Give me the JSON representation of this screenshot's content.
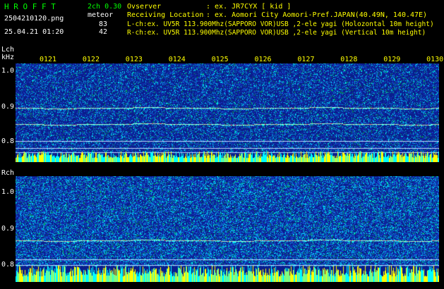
{
  "header": {
    "logo": "H R O F F T",
    "channels": "2ch 0.30",
    "meteor_label": "meteor",
    "filename": "2504210120.png",
    "datetime": "25.04.21 01:20",
    "lch_count": "83",
    "rch_count": "42",
    "observer_label": "Ovserver",
    "observer_value": ": ex. JR7CYX [ kid ]",
    "location_label": "Receiving Location",
    "location_value": ": ex. Aomori City Aomori-Pref.JAPAN(40.49N, 140.47E)",
    "lch_desc": "L-ch:ex. UV5R 113.900Mhz(SAPPORO VOR)USB ,2-ele yagi (Holozontal 10m height)",
    "rch_desc": "R-ch:ex. UV5R 113.900Mhz(SAPPORO VOR)USB ,2-ele yagi (Vertical 10m height)"
  },
  "time_ticks": [
    "0121",
    "0122",
    "0123",
    "0124",
    "0125",
    "0126",
    "0127",
    "0128",
    "0129",
    "0130"
  ],
  "lch_panel": {
    "label": "Lch",
    "unit": "kHz",
    "yticks": [
      "1.0",
      "0.9",
      "0.8"
    ],
    "signal_freqs_khz": [
      0.895,
      0.853
    ]
  },
  "rch_panel": {
    "label": "Rch",
    "yticks": [
      "1.0",
      "0.9",
      "0.8"
    ],
    "signal_freqs_khz": [
      0.868
    ]
  },
  "colors": {
    "background": "#000000",
    "spectrogram_bg": "#0a1e8c",
    "noise_cyan": "#00ffff",
    "noise_green": "#00c040",
    "signal": "#a0ffd0",
    "bar_yellow": "#ffff00",
    "bar_cyan": "#00ffff",
    "text_green": "#00ff00",
    "text_yellow": "#ffff00"
  }
}
